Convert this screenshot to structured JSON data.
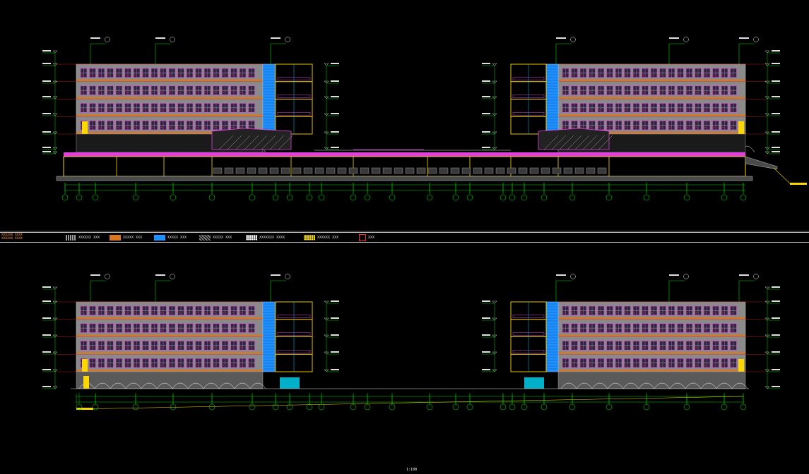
{
  "drawing": {
    "background": "#000000",
    "colors": {
      "facade_grey": "#8a8a8a",
      "window_magenta": "#e040e0",
      "floor_band_orange": "#d9771e",
      "stair_blue": "#1e90ff",
      "grid_green": "#00d000",
      "level_red": "#e02020",
      "outline_yellow": "#ffd700",
      "annotation_white": "#e0e0e0"
    },
    "legend": {
      "title_lines": [
        "XXXXXX XXXX",
        "XXXXXX XXXX"
      ],
      "items": [
        {
          "label": "XXXXXX XXX",
          "swatch": "#9a9a9a",
          "pattern": "hatch"
        },
        {
          "label": "XXXXX XXX",
          "swatch": "#d9771e",
          "pattern": "solid"
        },
        {
          "label": "XXXXX XXX",
          "swatch": "#1e90ff",
          "pattern": "solid"
        },
        {
          "label": "XXXXX XXX",
          "swatch": "#7a7a7a",
          "pattern": "diagonal"
        },
        {
          "label": "XXXXXXX XXXX",
          "swatch": "#ffffff",
          "pattern": "dots"
        },
        {
          "label": "XXXXXX XXX",
          "swatch": "#ffe000",
          "pattern": "dots"
        },
        {
          "label": "XXX",
          "swatch": "#ff2a2a",
          "pattern": "triangle"
        }
      ],
      "scale_note": "1:100"
    }
  }
}
